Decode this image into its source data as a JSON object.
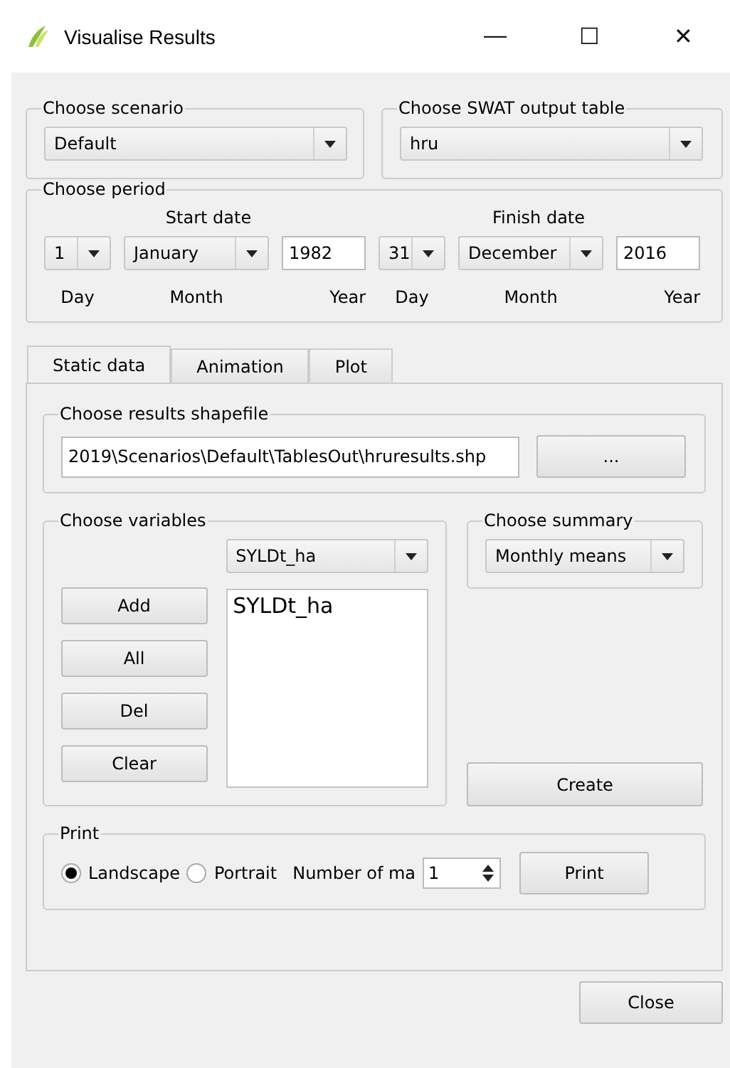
{
  "window": {
    "title": "Visualise Results",
    "controls": [
      "—",
      "☐",
      "✕"
    ]
  },
  "scenario": {
    "label": "Choose scenario",
    "value": "Default"
  },
  "output_table": {
    "label": "Choose SWAT output table",
    "value": "hru"
  },
  "period": {
    "label": "Choose period",
    "start_label": "Start date",
    "finish_label": "Finish date",
    "fields": [
      {
        "kind": "combo",
        "value": "1",
        "caption": "Day"
      },
      {
        "kind": "combo",
        "value": "January",
        "caption": "Month"
      },
      {
        "kind": "text",
        "value": "1982",
        "caption": "Year"
      },
      {
        "kind": "combo",
        "value": "31",
        "caption": "Day"
      },
      {
        "kind": "combo",
        "value": "December",
        "caption": "Month"
      },
      {
        "kind": "text",
        "value": "2016",
        "caption": "Year"
      }
    ]
  },
  "tabs": [
    {
      "label": "Static data",
      "selected": true
    },
    {
      "label": "Animation",
      "selected": false
    },
    {
      "label": "Plot",
      "selected": false
    }
  ],
  "shapefile": {
    "label": "Choose results shapefile",
    "value": "2019\\Scenarios\\Default\\TablesOut\\hruresults.shp",
    "browse": "..."
  },
  "variables": {
    "label": "Choose variables",
    "combo": "SYLDt_ha",
    "buttons": [
      "Add",
      "All",
      "Del",
      "Clear"
    ],
    "list": [
      {
        "label": "SYLDt_ha",
        "selected": false
      }
    ]
  },
  "summary": {
    "label": "Choose summary",
    "value": "Monthly means"
  },
  "create": "Create",
  "print": {
    "label": "Print",
    "options": [
      {
        "label": "Landscape",
        "selected": true
      },
      {
        "label": "Portrait",
        "selected": false
      }
    ],
    "count_label": "Number of ma",
    "count": "1",
    "button": "Print"
  },
  "close": "Close"
}
